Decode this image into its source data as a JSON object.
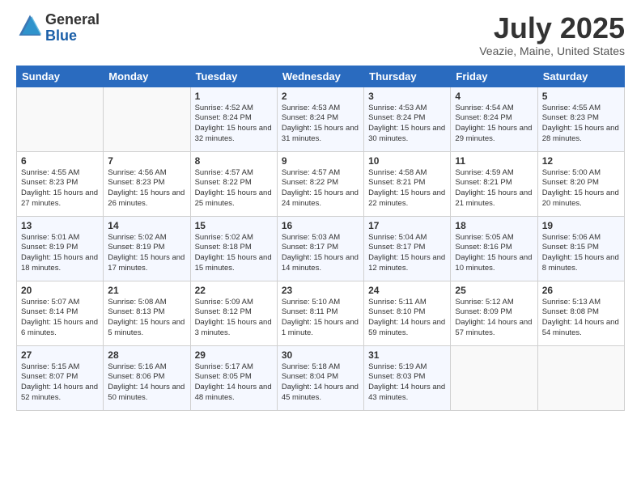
{
  "header": {
    "logo_general": "General",
    "logo_blue": "Blue",
    "month_title": "July 2025",
    "location": "Veazie, Maine, United States"
  },
  "days_of_week": [
    "Sunday",
    "Monday",
    "Tuesday",
    "Wednesday",
    "Thursday",
    "Friday",
    "Saturday"
  ],
  "weeks": [
    [
      {
        "day": "",
        "sunrise": "",
        "sunset": "",
        "daylight": ""
      },
      {
        "day": "",
        "sunrise": "",
        "sunset": "",
        "daylight": ""
      },
      {
        "day": "1",
        "sunrise": "Sunrise: 4:52 AM",
        "sunset": "Sunset: 8:24 PM",
        "daylight": "Daylight: 15 hours and 32 minutes."
      },
      {
        "day": "2",
        "sunrise": "Sunrise: 4:53 AM",
        "sunset": "Sunset: 8:24 PM",
        "daylight": "Daylight: 15 hours and 31 minutes."
      },
      {
        "day": "3",
        "sunrise": "Sunrise: 4:53 AM",
        "sunset": "Sunset: 8:24 PM",
        "daylight": "Daylight: 15 hours and 30 minutes."
      },
      {
        "day": "4",
        "sunrise": "Sunrise: 4:54 AM",
        "sunset": "Sunset: 8:24 PM",
        "daylight": "Daylight: 15 hours and 29 minutes."
      },
      {
        "day": "5",
        "sunrise": "Sunrise: 4:55 AM",
        "sunset": "Sunset: 8:23 PM",
        "daylight": "Daylight: 15 hours and 28 minutes."
      }
    ],
    [
      {
        "day": "6",
        "sunrise": "Sunrise: 4:55 AM",
        "sunset": "Sunset: 8:23 PM",
        "daylight": "Daylight: 15 hours and 27 minutes."
      },
      {
        "day": "7",
        "sunrise": "Sunrise: 4:56 AM",
        "sunset": "Sunset: 8:23 PM",
        "daylight": "Daylight: 15 hours and 26 minutes."
      },
      {
        "day": "8",
        "sunrise": "Sunrise: 4:57 AM",
        "sunset": "Sunset: 8:22 PM",
        "daylight": "Daylight: 15 hours and 25 minutes."
      },
      {
        "day": "9",
        "sunrise": "Sunrise: 4:57 AM",
        "sunset": "Sunset: 8:22 PM",
        "daylight": "Daylight: 15 hours and 24 minutes."
      },
      {
        "day": "10",
        "sunrise": "Sunrise: 4:58 AM",
        "sunset": "Sunset: 8:21 PM",
        "daylight": "Daylight: 15 hours and 22 minutes."
      },
      {
        "day": "11",
        "sunrise": "Sunrise: 4:59 AM",
        "sunset": "Sunset: 8:21 PM",
        "daylight": "Daylight: 15 hours and 21 minutes."
      },
      {
        "day": "12",
        "sunrise": "Sunrise: 5:00 AM",
        "sunset": "Sunset: 8:20 PM",
        "daylight": "Daylight: 15 hours and 20 minutes."
      }
    ],
    [
      {
        "day": "13",
        "sunrise": "Sunrise: 5:01 AM",
        "sunset": "Sunset: 8:19 PM",
        "daylight": "Daylight: 15 hours and 18 minutes."
      },
      {
        "day": "14",
        "sunrise": "Sunrise: 5:02 AM",
        "sunset": "Sunset: 8:19 PM",
        "daylight": "Daylight: 15 hours and 17 minutes."
      },
      {
        "day": "15",
        "sunrise": "Sunrise: 5:02 AM",
        "sunset": "Sunset: 8:18 PM",
        "daylight": "Daylight: 15 hours and 15 minutes."
      },
      {
        "day": "16",
        "sunrise": "Sunrise: 5:03 AM",
        "sunset": "Sunset: 8:17 PM",
        "daylight": "Daylight: 15 hours and 14 minutes."
      },
      {
        "day": "17",
        "sunrise": "Sunrise: 5:04 AM",
        "sunset": "Sunset: 8:17 PM",
        "daylight": "Daylight: 15 hours and 12 minutes."
      },
      {
        "day": "18",
        "sunrise": "Sunrise: 5:05 AM",
        "sunset": "Sunset: 8:16 PM",
        "daylight": "Daylight: 15 hours and 10 minutes."
      },
      {
        "day": "19",
        "sunrise": "Sunrise: 5:06 AM",
        "sunset": "Sunset: 8:15 PM",
        "daylight": "Daylight: 15 hours and 8 minutes."
      }
    ],
    [
      {
        "day": "20",
        "sunrise": "Sunrise: 5:07 AM",
        "sunset": "Sunset: 8:14 PM",
        "daylight": "Daylight: 15 hours and 6 minutes."
      },
      {
        "day": "21",
        "sunrise": "Sunrise: 5:08 AM",
        "sunset": "Sunset: 8:13 PM",
        "daylight": "Daylight: 15 hours and 5 minutes."
      },
      {
        "day": "22",
        "sunrise": "Sunrise: 5:09 AM",
        "sunset": "Sunset: 8:12 PM",
        "daylight": "Daylight: 15 hours and 3 minutes."
      },
      {
        "day": "23",
        "sunrise": "Sunrise: 5:10 AM",
        "sunset": "Sunset: 8:11 PM",
        "daylight": "Daylight: 15 hours and 1 minute."
      },
      {
        "day": "24",
        "sunrise": "Sunrise: 5:11 AM",
        "sunset": "Sunset: 8:10 PM",
        "daylight": "Daylight: 14 hours and 59 minutes."
      },
      {
        "day": "25",
        "sunrise": "Sunrise: 5:12 AM",
        "sunset": "Sunset: 8:09 PM",
        "daylight": "Daylight: 14 hours and 57 minutes."
      },
      {
        "day": "26",
        "sunrise": "Sunrise: 5:13 AM",
        "sunset": "Sunset: 8:08 PM",
        "daylight": "Daylight: 14 hours and 54 minutes."
      }
    ],
    [
      {
        "day": "27",
        "sunrise": "Sunrise: 5:15 AM",
        "sunset": "Sunset: 8:07 PM",
        "daylight": "Daylight: 14 hours and 52 minutes."
      },
      {
        "day": "28",
        "sunrise": "Sunrise: 5:16 AM",
        "sunset": "Sunset: 8:06 PM",
        "daylight": "Daylight: 14 hours and 50 minutes."
      },
      {
        "day": "29",
        "sunrise": "Sunrise: 5:17 AM",
        "sunset": "Sunset: 8:05 PM",
        "daylight": "Daylight: 14 hours and 48 minutes."
      },
      {
        "day": "30",
        "sunrise": "Sunrise: 5:18 AM",
        "sunset": "Sunset: 8:04 PM",
        "daylight": "Daylight: 14 hours and 45 minutes."
      },
      {
        "day": "31",
        "sunrise": "Sunrise: 5:19 AM",
        "sunset": "Sunset: 8:03 PM",
        "daylight": "Daylight: 14 hours and 43 minutes."
      },
      {
        "day": "",
        "sunrise": "",
        "sunset": "",
        "daylight": ""
      },
      {
        "day": "",
        "sunrise": "",
        "sunset": "",
        "daylight": ""
      }
    ]
  ]
}
